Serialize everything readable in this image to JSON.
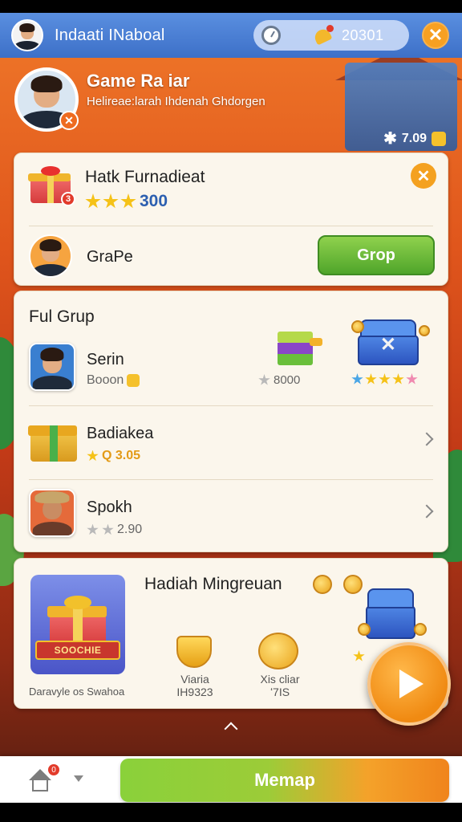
{
  "topbar": {
    "title": "Indaati INaboal",
    "currency_value": "20301",
    "close_symbol": "✕"
  },
  "profile": {
    "name": "Game Ra iar",
    "subtitle": "Helireae:larah Ihdenah Ghdorgen",
    "badge_symbol": "✕",
    "points": "7.09",
    "points_symbol": "✱"
  },
  "card1": {
    "title": "Hatk Furnadieat",
    "stars_value": "300",
    "gift_badge": "3",
    "close_symbol": "✕",
    "user_name": "GraPe",
    "button_label": "Grop"
  },
  "card2": {
    "heading": "Ful Grup",
    "rows": [
      {
        "name": "Serin",
        "sub": "Booon"
      },
      {
        "name": "Badiakea",
        "sub": "Q 3.05"
      },
      {
        "name": "Spokh",
        "sub": "2.90"
      }
    ],
    "hatch_value": "8000"
  },
  "card3": {
    "heading": "Hadiah Mingreuan",
    "art_banner": "SOOCHIE",
    "art_caption": "Daravyle os Swahoa",
    "rewards": [
      {
        "label": "Viaria",
        "value": "IH9323"
      },
      {
        "label": "Xis cliar",
        "value": "ʻ7IS"
      }
    ]
  },
  "bottombar": {
    "home_badge": "0",
    "main_button": "Memap"
  },
  "colors": {
    "topbar": "#3d70c8",
    "accent_orange": "#f4a120",
    "accent_green": "#4fa52a",
    "card_bg": "#fbf6ec"
  },
  "icons": [
    "clock-icon",
    "bell-icon",
    "close-icon",
    "gift-icon",
    "star-icon",
    "chest-icon",
    "coin-icon",
    "play-icon",
    "home-icon",
    "chevron-right-icon",
    "chevron-up-icon"
  ]
}
